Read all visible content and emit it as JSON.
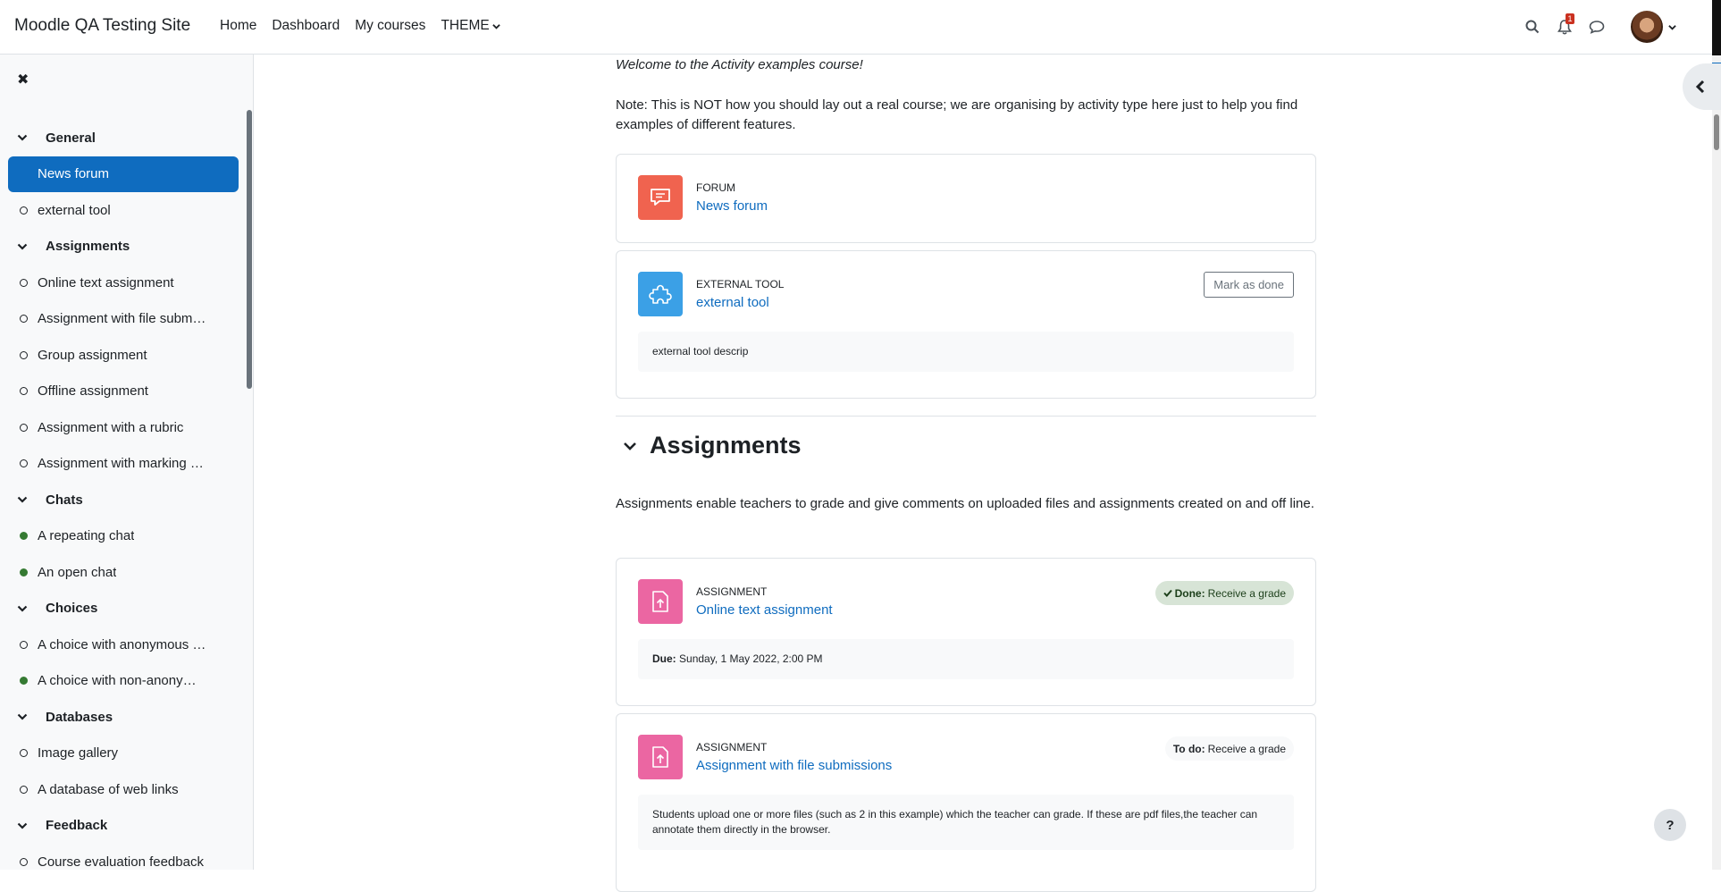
{
  "navbar": {
    "site_name": "Moodle QA Testing Site",
    "links": [
      "Home",
      "Dashboard",
      "My courses"
    ],
    "theme_label": "THEME",
    "notification_count": "1"
  },
  "drawer": {
    "close_symbol": "✖",
    "items": [
      {
        "kind": "section",
        "label": "General"
      },
      {
        "kind": "activity",
        "label": "News forum",
        "active": true
      },
      {
        "kind": "activity",
        "label": "external tool"
      },
      {
        "kind": "section",
        "label": "Assignments"
      },
      {
        "kind": "activity",
        "label": "Online text assignment"
      },
      {
        "kind": "activity",
        "label": "Assignment with file subm…"
      },
      {
        "kind": "activity",
        "label": "Group assignment"
      },
      {
        "kind": "activity",
        "label": "Offline assignment"
      },
      {
        "kind": "activity",
        "label": "Assignment with a rubric"
      },
      {
        "kind": "activity",
        "label": "Assignment with marking …"
      },
      {
        "kind": "section",
        "label": "Chats"
      },
      {
        "kind": "activity",
        "label": "A repeating chat",
        "done": true
      },
      {
        "kind": "activity",
        "label": "An open chat",
        "done": true
      },
      {
        "kind": "section",
        "label": "Choices"
      },
      {
        "kind": "activity",
        "label": "A choice with anonymous …"
      },
      {
        "kind": "activity",
        "label": "A choice with non-anonym…",
        "done": true
      },
      {
        "kind": "section",
        "label": "Databases"
      },
      {
        "kind": "activity",
        "label": "Image gallery"
      },
      {
        "kind": "activity",
        "label": "A database of web links"
      },
      {
        "kind": "section",
        "label": "Feedback"
      },
      {
        "kind": "activity",
        "label": "Course evaluation feedback"
      }
    ]
  },
  "main": {
    "welcome": "Welcome to the Activity examples course!",
    "note": "Note: This is NOT how you should lay out a real course; we are organising by activity type here just to help you find examples of different features.",
    "forum_card": {
      "type": "FORUM",
      "name": "News forum",
      "color": "#f0634f"
    },
    "tool_card": {
      "type": "EXTERNAL TOOL",
      "name": "external tool",
      "color": "#3ba0e6",
      "button": "Mark as done",
      "description": "external tool descrip"
    },
    "section": {
      "title": "Assignments",
      "summary": "Assignments enable teachers to grade and give comments on uploaded files and assignments created on and off line."
    },
    "assign1": {
      "type": "ASSIGNMENT",
      "name": "Online text assignment",
      "color": "#eb66a2",
      "status_label": "Done:",
      "status_text": "Receive a grade",
      "due_label": "Due:",
      "due_text": "Sunday, 1 May 2022, 2:00 PM"
    },
    "assign2": {
      "type": "ASSIGNMENT",
      "name": "Assignment with file submissions",
      "color": "#eb66a2",
      "status_label": "To do:",
      "status_text": "Receive a grade",
      "description": "Students upload one or more files (such as 2 in this example) which the teacher can grade. If these are pdf files,the teacher can annotate them directly in the browser."
    }
  },
  "help_label": "?",
  "colors": {
    "primary": "#0f6cbf",
    "success": "#357a32",
    "forum": "#f0634f",
    "lti": "#3ba0e6",
    "assign": "#eb66a2"
  }
}
